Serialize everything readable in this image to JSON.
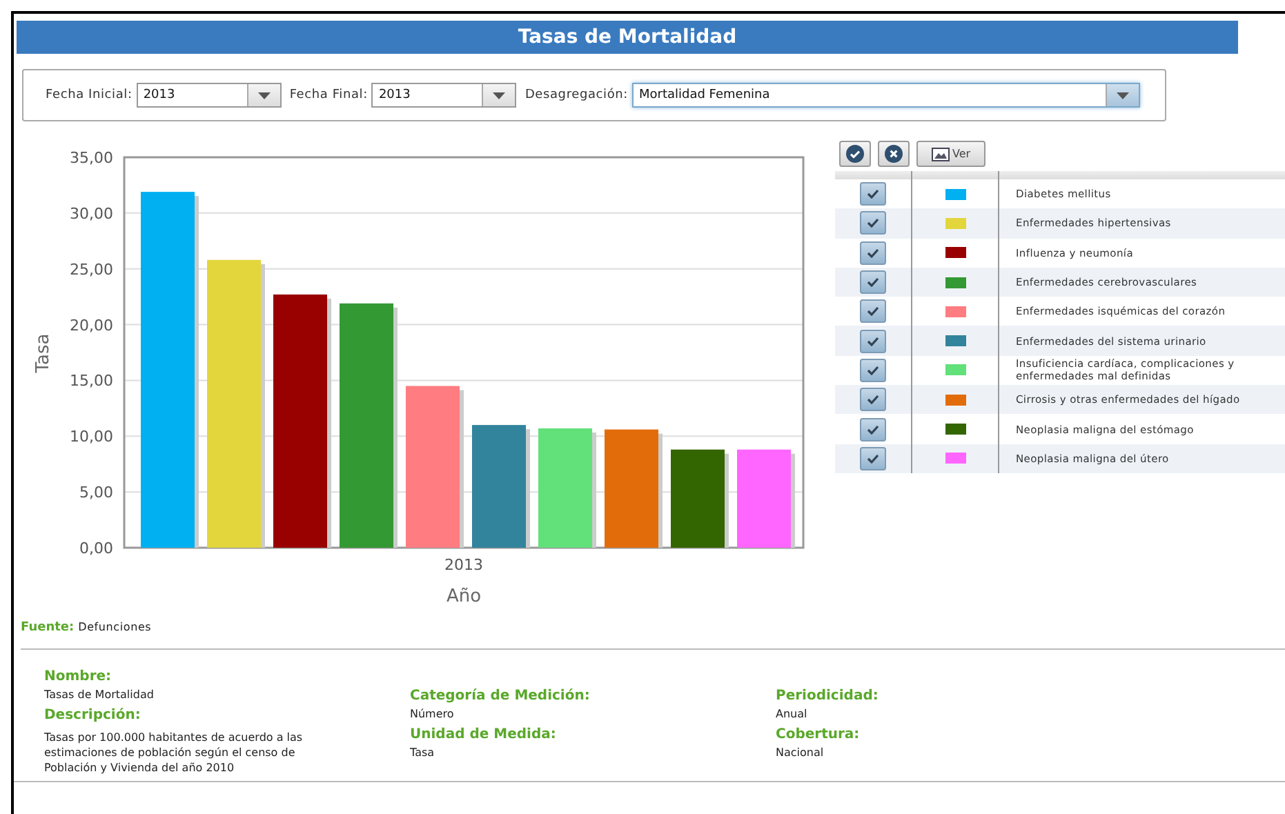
{
  "title": "Tasas de Mortalidad",
  "filters": [
    {
      "label": "Fecha Inicial:",
      "value": "2013",
      "kind": "short"
    },
    {
      "label": "Fecha Final:",
      "value": "2013",
      "kind": "short"
    },
    {
      "label": "Desagregación:",
      "value": "Mortalidad Femenina",
      "kind": "wide"
    }
  ],
  "chart": {
    "chart_data": {
      "type": "bar",
      "xlabel": "Año",
      "ylabel": "Tasa",
      "categories": [
        "2013"
      ],
      "ylim": [
        0,
        35
      ],
      "grid": true,
      "yticks": [
        {
          "value": 0,
          "label": "0,00"
        },
        {
          "value": 5,
          "label": "5,00"
        },
        {
          "value": 10,
          "label": "10,00"
        },
        {
          "value": 15,
          "label": "15,00"
        },
        {
          "value": 20,
          "label": "20,00"
        },
        {
          "value": 25,
          "label": "25,00"
        },
        {
          "value": 30,
          "label": "30,00"
        },
        {
          "value": 35,
          "label": "35,00"
        }
      ],
      "series": [
        {
          "name": "Diabetes mellitus",
          "color": "#00b0f0",
          "values": [
            31.9
          ]
        },
        {
          "name": "Enfermedades hipertensivas",
          "color": "#e3d63c",
          "values": [
            25.8
          ]
        },
        {
          "name": "Influenza y neumonía",
          "color": "#990000",
          "values": [
            22.7
          ]
        },
        {
          "name": "Enfermedades cerebrovasculares",
          "color": "#339933",
          "values": [
            21.9
          ]
        },
        {
          "name": "Enfermedades isquémicas del corazón",
          "color": "#ff7c80",
          "values": [
            14.5
          ]
        },
        {
          "name": "Enfermedades del sistema urinario",
          "color": "#31849b",
          "values": [
            11.0
          ]
        },
        {
          "name": "Insuficiencia cardíaca, complicaciones y enfermedades mal definidas",
          "color": "#62e07a",
          "values": [
            10.7
          ]
        },
        {
          "name": "Cirrosis y otras enfermedades del hígado",
          "color": "#e36c0a",
          "values": [
            10.6
          ]
        },
        {
          "name": "Neoplasia maligna del estómago",
          "color": "#336600",
          "values": [
            8.8
          ]
        },
        {
          "name": "Neoplasia maligna del útero",
          "color": "#ff66ff",
          "values": [
            8.8
          ]
        }
      ]
    }
  },
  "legend": {
    "view_button": "Ver",
    "rows": [
      {
        "checked": true
      },
      {
        "checked": true
      },
      {
        "checked": true
      },
      {
        "checked": true
      },
      {
        "checked": true
      },
      {
        "checked": true
      },
      {
        "checked": true
      },
      {
        "checked": true
      },
      {
        "checked": true
      },
      {
        "checked": true
      }
    ]
  },
  "source": {
    "label": "Fuente:",
    "value": "Defunciones"
  },
  "info": [
    [
      {
        "label": "Nombre:",
        "value": "Tasas de Mortalidad"
      },
      {
        "label": "Descripción:",
        "value": "Tasas por 100.000 habitantes de acuerdo a las estimaciones de población según el censo de Población y Vivienda del año 2010"
      }
    ],
    [
      {
        "label": "Categoría de Medición:",
        "value": "Número"
      },
      {
        "label": "Unidad de Medida:",
        "value": "Tasa"
      }
    ],
    [
      {
        "label": "Periodicidad:",
        "value": "Anual"
      },
      {
        "label": "Cobertura:",
        "value": "Nacional"
      }
    ]
  ]
}
